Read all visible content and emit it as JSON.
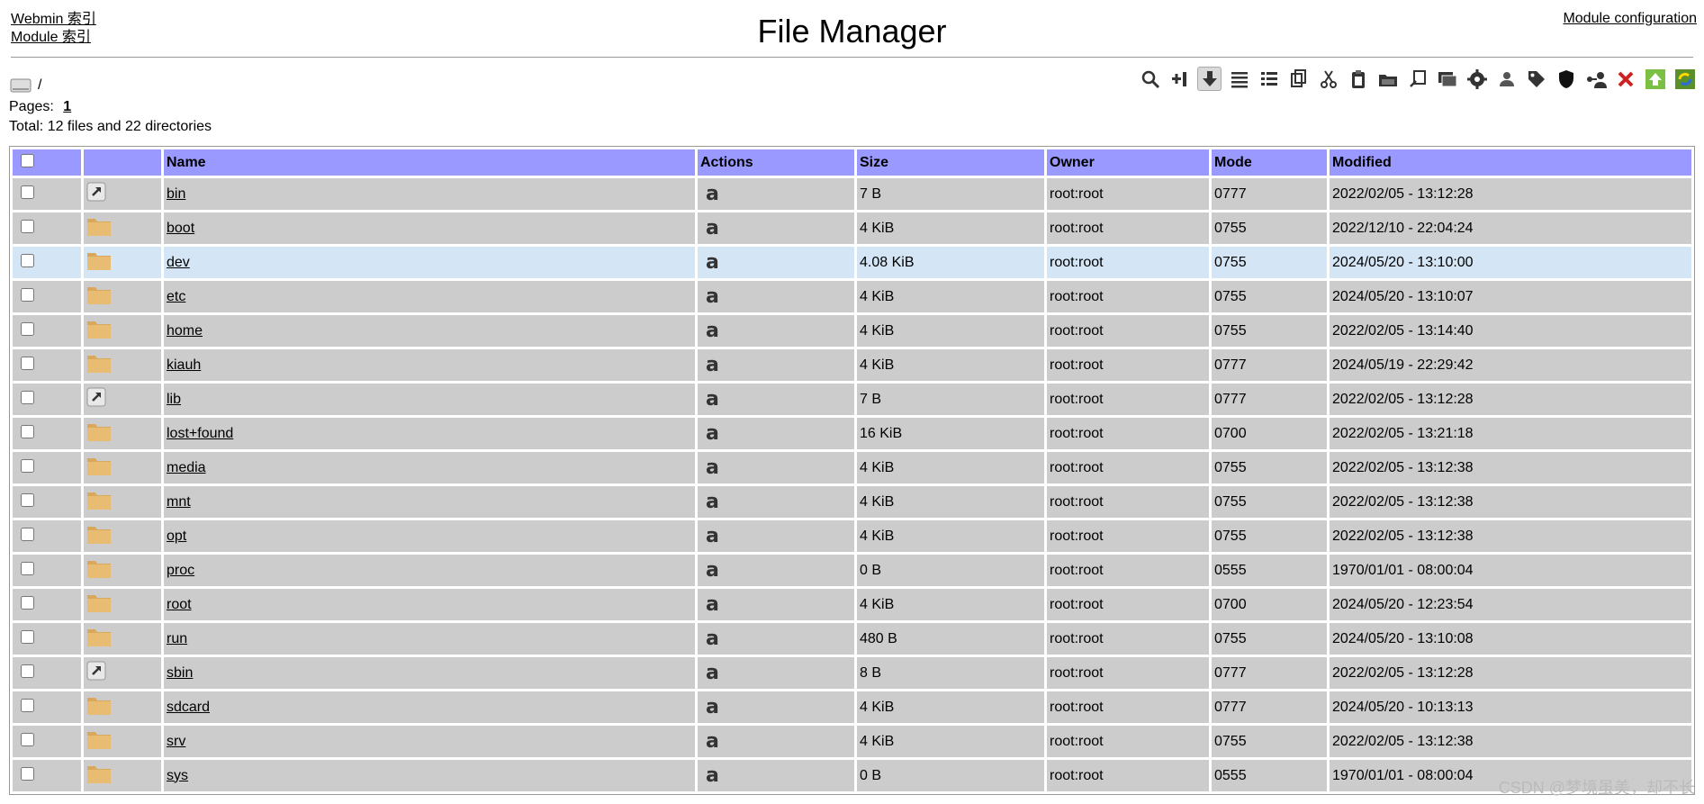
{
  "header": {
    "title": "File Manager",
    "webmin_index": "Webmin 索引",
    "module_index": "Module 索引",
    "module_config": "Module configuration"
  },
  "path": "/",
  "pages_label": "Pages:",
  "current_page": "1",
  "total_text": "Total: 12 files and 22 directories",
  "toolbar_icons": [
    "search-icon",
    "add-bookmark-icon",
    "download-icon",
    "list-icon",
    "detail-list-icon",
    "copy-icon",
    "cut-icon",
    "paste-icon",
    "folder-icon",
    "bookmark-icon",
    "terminal-icon",
    "settings-icon",
    "user-icon",
    "tag-icon",
    "shield-icon",
    "share-icon",
    "delete-icon",
    "upload-icon",
    "refresh-icon"
  ],
  "table": {
    "headers": {
      "name": "Name",
      "actions": "Actions",
      "size": "Size",
      "owner": "Owner",
      "mode": "Mode",
      "modified": "Modified"
    },
    "rows": [
      {
        "type": "link",
        "name": "bin",
        "size": "7 B",
        "owner": "root:root",
        "mode": "0777",
        "modified": "2022/02/05 - 13:12:28"
      },
      {
        "type": "folder",
        "name": "boot",
        "size": "4 KiB",
        "owner": "root:root",
        "mode": "0755",
        "modified": "2022/12/10 - 22:04:24"
      },
      {
        "type": "folder",
        "name": "dev",
        "size": "4.08 KiB",
        "owner": "root:root",
        "mode": "0755",
        "modified": "2024/05/20 - 13:10:00",
        "highlight": true
      },
      {
        "type": "folder",
        "name": "etc",
        "size": "4 KiB",
        "owner": "root:root",
        "mode": "0755",
        "modified": "2024/05/20 - 13:10:07"
      },
      {
        "type": "folder",
        "name": "home",
        "size": "4 KiB",
        "owner": "root:root",
        "mode": "0755",
        "modified": "2022/02/05 - 13:14:40"
      },
      {
        "type": "folder",
        "name": "kiauh",
        "size": "4 KiB",
        "owner": "root:root",
        "mode": "0777",
        "modified": "2024/05/19 - 22:29:42"
      },
      {
        "type": "link",
        "name": "lib",
        "size": "7 B",
        "owner": "root:root",
        "mode": "0777",
        "modified": "2022/02/05 - 13:12:28"
      },
      {
        "type": "folder",
        "name": "lost+found",
        "size": "16 KiB",
        "owner": "root:root",
        "mode": "0700",
        "modified": "2022/02/05 - 13:21:18"
      },
      {
        "type": "folder",
        "name": "media",
        "size": "4 KiB",
        "owner": "root:root",
        "mode": "0755",
        "modified": "2022/02/05 - 13:12:38"
      },
      {
        "type": "folder",
        "name": "mnt",
        "size": "4 KiB",
        "owner": "root:root",
        "mode": "0755",
        "modified": "2022/02/05 - 13:12:38"
      },
      {
        "type": "folder",
        "name": "opt",
        "size": "4 KiB",
        "owner": "root:root",
        "mode": "0755",
        "modified": "2022/02/05 - 13:12:38"
      },
      {
        "type": "folder",
        "name": "proc",
        "size": "0 B",
        "owner": "root:root",
        "mode": "0555",
        "modified": "1970/01/01 - 08:00:04"
      },
      {
        "type": "folder",
        "name": "root",
        "size": "4 KiB",
        "owner": "root:root",
        "mode": "0700",
        "modified": "2024/05/20 - 12:23:54"
      },
      {
        "type": "folder",
        "name": "run",
        "size": "480 B",
        "owner": "root:root",
        "mode": "0755",
        "modified": "2024/05/20 - 13:10:08"
      },
      {
        "type": "link",
        "name": "sbin",
        "size": "8 B",
        "owner": "root:root",
        "mode": "0777",
        "modified": "2022/02/05 - 13:12:28"
      },
      {
        "type": "folder",
        "name": "sdcard",
        "size": "4 KiB",
        "owner": "root:root",
        "mode": "0777",
        "modified": "2024/05/20 - 10:13:13"
      },
      {
        "type": "folder",
        "name": "srv",
        "size": "4 KiB",
        "owner": "root:root",
        "mode": "0755",
        "modified": "2022/02/05 - 13:12:38"
      },
      {
        "type": "folder",
        "name": "sys",
        "size": "0 B",
        "owner": "root:root",
        "mode": "0555",
        "modified": "1970/01/01 - 08:00:04"
      }
    ]
  },
  "watermark": "CSDN @梦境虽美，却不长"
}
